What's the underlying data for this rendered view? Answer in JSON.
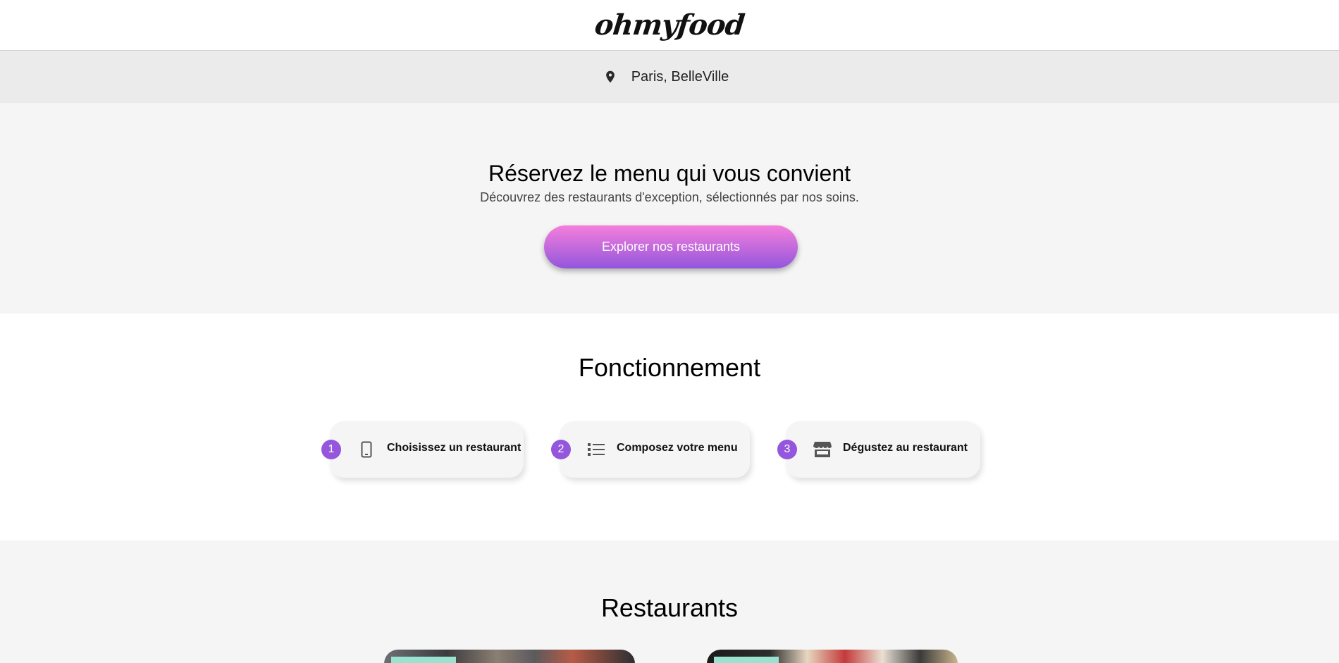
{
  "header": {
    "logo_text": "ohmyfood"
  },
  "location": {
    "icon": "location-pin-icon",
    "text": "Paris, BelleVille"
  },
  "hero": {
    "title": "Réservez le menu qui vous convient",
    "subtitle": "Découvrez des restaurants d'exception, sélectionnés par nos soins.",
    "cta_label": "Explorer nos restaurants",
    "cta_gradient": [
      "#f57fdc",
      "#9356dc"
    ]
  },
  "how_it_works": {
    "title": "Fonctionnement",
    "accent_color": "#9356dc",
    "steps": [
      {
        "number": "1",
        "icon": "smartphone-icon",
        "label": "Choisissez un restaurant"
      },
      {
        "number": "2",
        "icon": "list-icon",
        "label": "Composez votre menu"
      },
      {
        "number": "3",
        "icon": "store-icon",
        "label": "Dégustez au restaurant"
      }
    ]
  },
  "restaurants": {
    "title": "Restaurants",
    "tag_color": "#99e2d0"
  }
}
